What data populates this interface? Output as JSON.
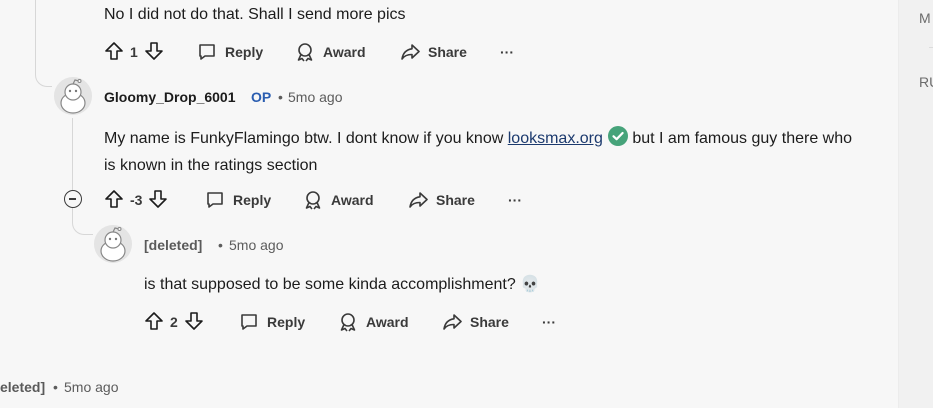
{
  "comment_top": {
    "text": "No I did not do that. Shall I send more pics",
    "score": "1"
  },
  "comment_op": {
    "username": "Gloomy_Drop_6001",
    "op_badge": "OP",
    "dot": "•",
    "age": "5mo ago",
    "text_before": "My name is FunkyFlamingo btw. I dont know if you know ",
    "link_text": "looksmax.org",
    "text_after": " but I am famous guy there who is known in the ratings section",
    "score": "-3"
  },
  "comment_reply": {
    "username": "[deleted]",
    "dot": "•",
    "age": "5mo ago",
    "text": "is that supposed to be some kinda accomplishment?",
    "emoji": "💀",
    "score": "2"
  },
  "comment_bottom": {
    "username": "eleted]",
    "dot": "•",
    "age": "5mo ago"
  },
  "actions": {
    "reply": "Reply",
    "award": "Award",
    "share": "Share",
    "more": "···"
  },
  "right_panel": {
    "text_1": "M",
    "text_2": "RU"
  },
  "colors": {
    "op_badge": "#2a5db0",
    "verified": "#46a37a",
    "background": "#f7f7f7"
  },
  "icons": [
    "upvote-icon",
    "downvote-icon",
    "reply-icon",
    "award-icon",
    "share-icon",
    "more-icon",
    "collapse-icon",
    "verified-icon",
    "skull-emoji"
  ]
}
